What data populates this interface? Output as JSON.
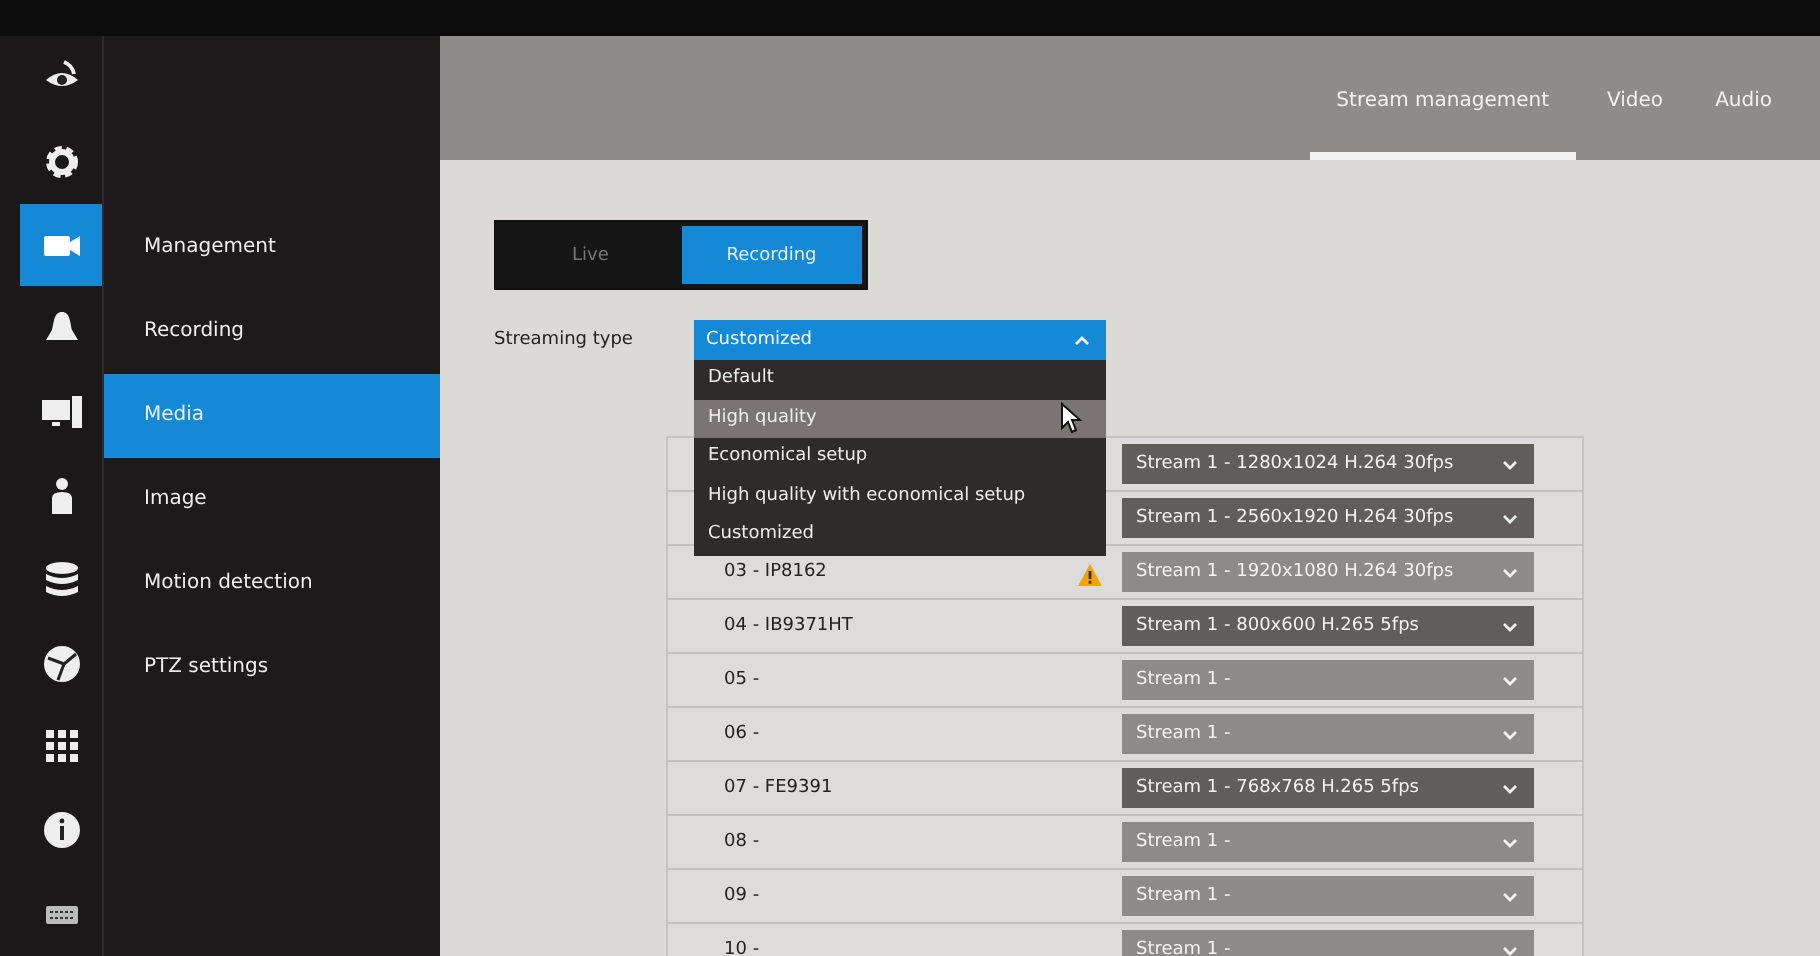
{
  "rail": [
    {
      "kind": "eye",
      "selected": false
    },
    {
      "kind": "gear",
      "selected": false
    },
    {
      "kind": "camera",
      "selected": true
    },
    {
      "kind": "bell",
      "selected": false
    },
    {
      "kind": "monitor",
      "selected": false
    },
    {
      "kind": "person",
      "selected": false
    },
    {
      "kind": "storage",
      "selected": false
    },
    {
      "kind": "globe",
      "selected": false
    },
    {
      "kind": "grid",
      "selected": false
    },
    {
      "kind": "info",
      "selected": false
    },
    {
      "kind": "keyboard",
      "selected": false
    }
  ],
  "submenu": [
    {
      "label": "Management",
      "selected": false
    },
    {
      "label": "Recording",
      "selected": false
    },
    {
      "label": "Media",
      "selected": true
    },
    {
      "label": "Image",
      "selected": false
    },
    {
      "label": "Motion detection",
      "selected": false
    },
    {
      "label": "PTZ settings",
      "selected": false
    }
  ],
  "tabs": [
    {
      "label": "Stream management",
      "selected": true
    },
    {
      "label": "Video",
      "selected": false
    },
    {
      "label": "Audio",
      "selected": false
    }
  ],
  "mode": [
    {
      "label": "Live",
      "selected": false
    },
    {
      "label": "Recording",
      "selected": true
    }
  ],
  "streaming_type": {
    "label": "Streaming type",
    "value": "Customized",
    "expanded": true,
    "options": [
      {
        "label": "Default",
        "highlighted": false
      },
      {
        "label": "High quality",
        "highlighted": true
      },
      {
        "label": "Economical setup",
        "highlighted": false
      },
      {
        "label": "High quality with economical setup",
        "highlighted": false
      },
      {
        "label": "Customized",
        "highlighted": false
      }
    ]
  },
  "channels": [
    {
      "stream": "Stream 1 - 1280x1024 H.264 30fps",
      "disabled": false
    },
    {
      "stream": "Stream 1 - 2560x1920 H.264 30fps",
      "disabled": false
    },
    {
      "name": "03 - IP8162",
      "stream": "Stream 1 - 1920x1080 H.264 30fps",
      "disabled": true,
      "warning": true
    },
    {
      "name": "04 - IB9371HT",
      "stream": "Stream 1 - 800x600 H.265 5fps",
      "disabled": false
    },
    {
      "name": "05 -",
      "stream": "Stream 1 -",
      "disabled": true
    },
    {
      "name": "06 -",
      "stream": "Stream 1 -",
      "disabled": true
    },
    {
      "name": "07 - FE9391",
      "stream": "Stream 1 - 768x768 H.265 5fps",
      "disabled": false
    },
    {
      "name": "08 -",
      "stream": "Stream 1 -",
      "disabled": true
    },
    {
      "name": "09 -",
      "stream": "Stream 1 -",
      "disabled": true
    },
    {
      "name": "10 -",
      "stream": "Stream 1 -",
      "disabled": true
    }
  ]
}
